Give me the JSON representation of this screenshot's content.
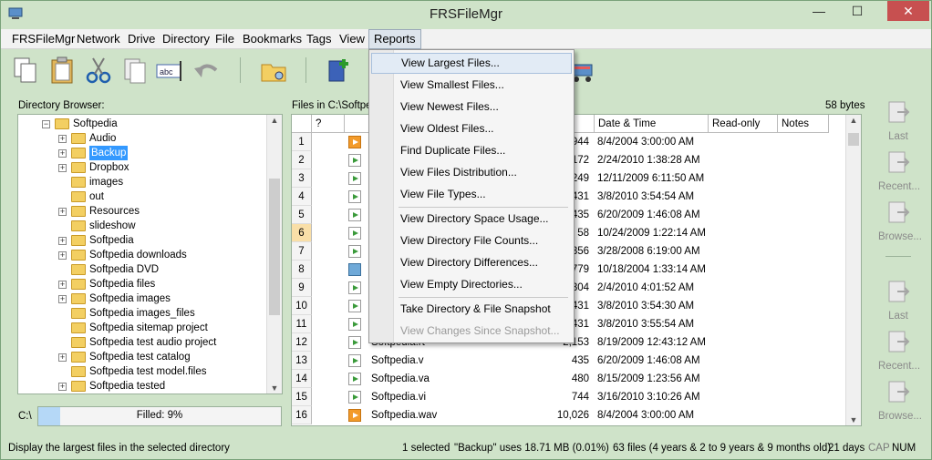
{
  "window": {
    "title": "FRSFileMgr",
    "min": "—",
    "max": "☐",
    "close": "✕"
  },
  "menu": [
    "FRSFileMgr",
    "Network",
    "Drive",
    "Directory",
    "File",
    "Bookmarks",
    "Tags",
    "View",
    "Reports"
  ],
  "directory_browser": {
    "label": "Directory Browser:",
    "items": [
      "Softpedia",
      "Audio",
      "Backup",
      "Dropbox",
      "images",
      "out",
      "Resources",
      "slideshow",
      "Softpedia",
      "Softpedia downloads",
      "Softpedia DVD",
      "Softpedia files",
      "Softpedia images",
      "Softpedia images_files",
      "Softpedia sitemap project",
      "Softpedia test audio project",
      "Softpedia test catalog",
      "Softpedia test model.files",
      "Softpedia tested"
    ],
    "drive": "C:\\",
    "filled": "Filled:  9%"
  },
  "files": {
    "label": "Files in C:\\Softpe",
    "size": "58 bytes",
    "columns": [
      "?",
      "Date & Time",
      "Read-only",
      "Notes"
    ],
    "rows": [
      {
        "n": "1",
        "name": "",
        "size": "944",
        "date": "8/4/2004 3:00:00 AM",
        "icon": "orange"
      },
      {
        "n": "2",
        "name": "",
        "size": "172",
        "date": "2/24/2010 1:38:28 AM",
        "icon": "green"
      },
      {
        "n": "3",
        "name": "",
        "size": "249",
        "date": "12/11/2009 6:11:50 AM",
        "icon": "green"
      },
      {
        "n": "4",
        "name": "",
        "size": "431",
        "date": "3/8/2010 3:54:54 AM",
        "icon": "green"
      },
      {
        "n": "5",
        "name": "",
        "size": "435",
        "date": "6/20/2009 1:46:08 AM",
        "icon": "green"
      },
      {
        "n": "6",
        "name": "",
        "size": "58",
        "date": "10/24/2009 1:22:14 AM",
        "icon": "green"
      },
      {
        "n": "7",
        "name": "",
        "size": "356",
        "date": "3/28/2008 6:19:00 AM",
        "icon": "green"
      },
      {
        "n": "8",
        "name": "",
        "size": "779",
        "date": "10/18/2004 1:33:14 AM",
        "icon": "img"
      },
      {
        "n": "9",
        "name": "",
        "size": "304",
        "date": "2/4/2010 4:01:52 AM",
        "icon": "green"
      },
      {
        "n": "10",
        "name": "",
        "size": "431",
        "date": "3/8/2010 3:54:30 AM",
        "icon": "green"
      },
      {
        "n": "11",
        "name": "",
        "size": "431",
        "date": "3/8/2010 3:55:54 AM",
        "icon": "green"
      },
      {
        "n": "12",
        "name": "Softpedia.rt",
        "size": "2,153",
        "date": "8/19/2009 12:43:12 AM",
        "icon": "green"
      },
      {
        "n": "13",
        "name": "Softpedia.v",
        "size": "435",
        "date": "6/20/2009 1:46:08 AM",
        "icon": "green"
      },
      {
        "n": "14",
        "name": "Softpedia.va",
        "size": "480",
        "date": "8/15/2009 1:23:56 AM",
        "icon": "green"
      },
      {
        "n": "15",
        "name": "Softpedia.vi",
        "size": "744",
        "date": "3/16/2010 3:10:26 AM",
        "icon": "green"
      },
      {
        "n": "16",
        "name": "Softpedia.wav",
        "size": "10,026",
        "date": "8/4/2004 3:00:00 AM",
        "icon": "orange"
      }
    ]
  },
  "reports_menu": [
    "View Largest Files...",
    "View Smallest Files...",
    "View Newest Files...",
    "View Oldest Files...",
    "Find Duplicate Files...",
    "View Files Distribution...",
    "View File Types...",
    "View Directory Space Usage...",
    "View Directory File Counts...",
    "View Directory Differences...",
    "View Empty Directories...",
    "Take Directory & File Snapshot",
    "View Changes Since Snapshot..."
  ],
  "side_buttons": [
    "Last",
    "Recent...",
    "Browse...",
    "Last",
    "Recent...",
    "Browse..."
  ],
  "status": {
    "hint": "Display the largest files in the selected directory",
    "selected": "1 selected",
    "usage": "\"Backup\" uses 18.71 MB (0.01%)",
    "files": "63 files (4 years & 2 to 9 years & 9 months old)",
    "days": "21 days",
    "cap": "CAP",
    "num": "NUM"
  },
  "colors": {
    "accent": "#3399ff",
    "chrome": "#cfe3c9",
    "close": "#c75050"
  }
}
